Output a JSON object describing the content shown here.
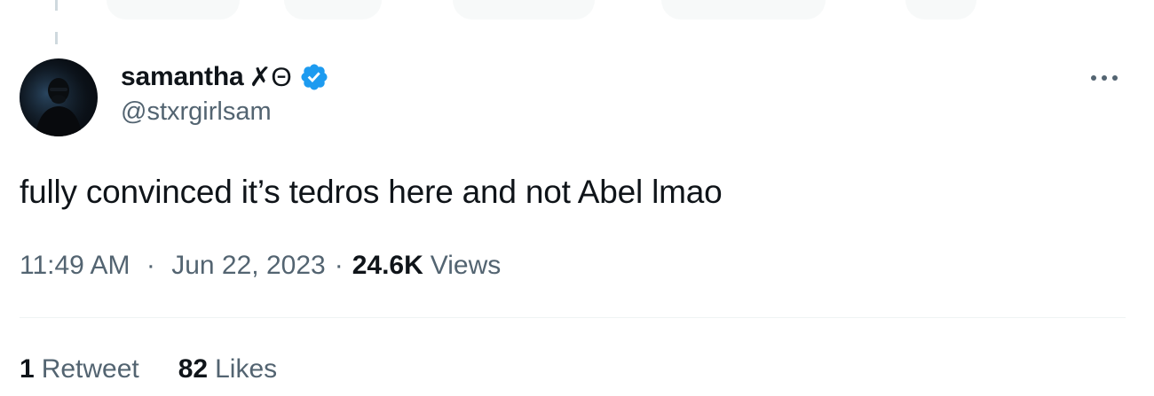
{
  "author": {
    "display_name": "samantha",
    "name_emoji": "✗Θ",
    "handle": "@stxrgirlsam",
    "verified": true
  },
  "tweet": {
    "text": "fully convinced it’s tedros here and not Abel lmao"
  },
  "meta": {
    "time": "11:49 AM",
    "separator": "·",
    "date": "Jun 22, 2023",
    "views_count": "24.6K",
    "views_label": "Views"
  },
  "stats": {
    "retweets_count": "1",
    "retweets_label": "Retweet",
    "likes_count": "82",
    "likes_label": "Likes"
  },
  "colors": {
    "verified_blue": "#1d9bf0",
    "secondary_text": "#536471",
    "primary_text": "#0f1419",
    "divider": "#eff3f4"
  },
  "icons": {
    "verified": "verified-badge-icon",
    "more": "more-horizontal-icon"
  }
}
